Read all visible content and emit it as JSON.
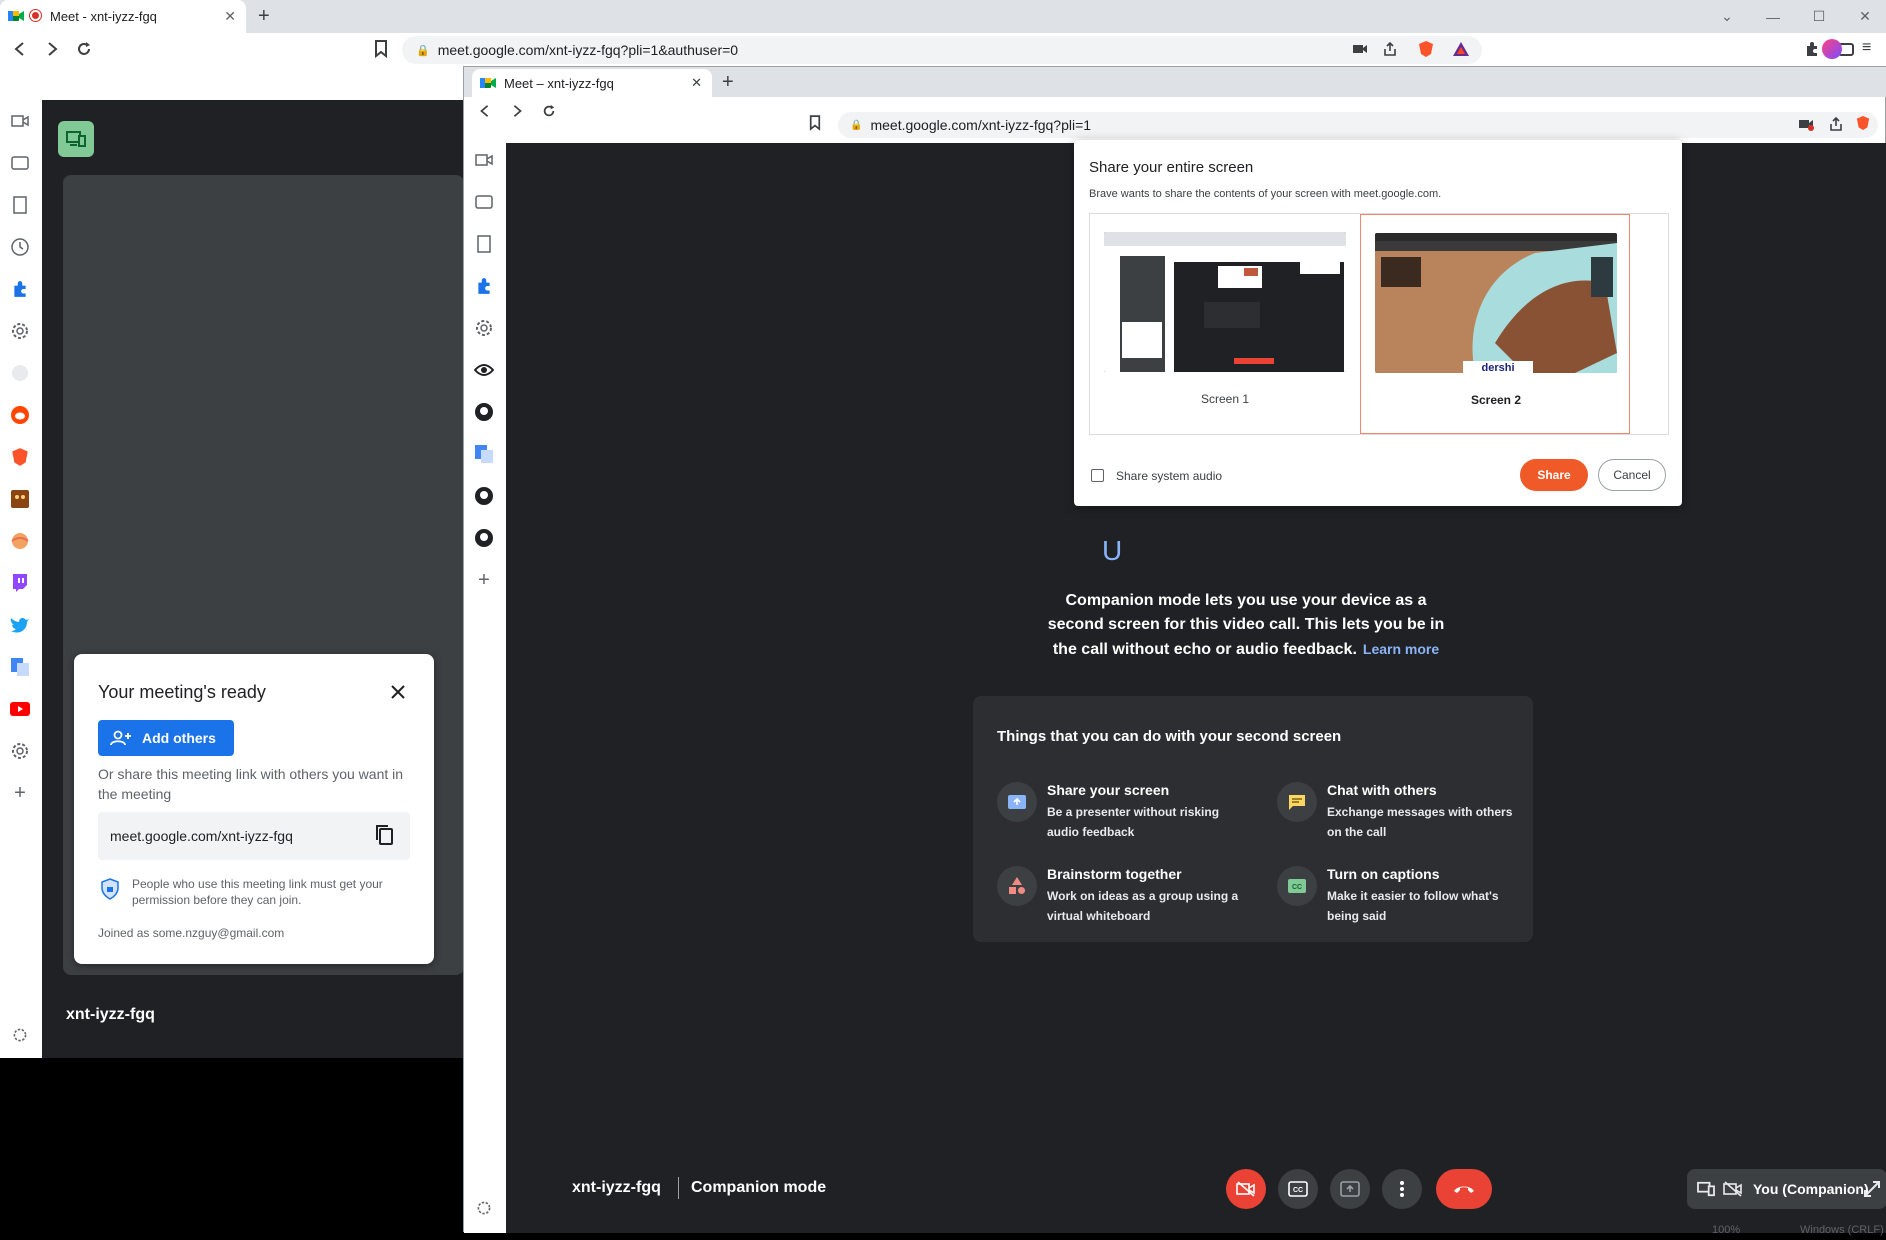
{
  "back_browser": {
    "tab_title": "Meet - xnt-iyzz-fgq",
    "url": "meet.google.com/xnt-iyzz-fgq?pli=1&authuser=0"
  },
  "back_meet": {
    "meeting_code": "xnt-iyzz-fgq"
  },
  "meeting_ready": {
    "title": "Your meeting's ready",
    "add_others_label": "Add others",
    "share_text": "Or share this meeting link with others you want in the meeting",
    "link": "meet.google.com/xnt-iyzz-fgq",
    "permission_note": "People who use this meeting link must get your permission before they can join.",
    "joined_as": "Joined as some.nzguy@gmail.com"
  },
  "front_browser": {
    "tab_title": "Meet – xnt-iyzz-fgq",
    "url": "meet.google.com/xnt-iyzz-fgq?pli=1"
  },
  "companion": {
    "partial_title": "U",
    "description": "Companion mode lets you use your device as a second screen for this video call. This lets you be in the call without echo or audio feedback.",
    "learn_more": "Learn more",
    "card_title": "Things that you can do with your second screen",
    "features": [
      {
        "title": "Share your screen",
        "desc": "Be a presenter without risking audio feedback",
        "icon": "present-icon"
      },
      {
        "title": "Chat with others",
        "desc": "Exchange messages with others on the call",
        "icon": "chat-icon"
      },
      {
        "title": "Brainstorm together",
        "desc": "Work on ideas as a group using a virtual whiteboard",
        "icon": "shapes-icon"
      },
      {
        "title": "Turn on captions",
        "desc": "Make it easier to follow what's being said",
        "icon": "captions-icon"
      }
    ]
  },
  "bottom_bar": {
    "meeting_code": "xnt-iyzz-fgq",
    "mode": "Companion mode"
  },
  "self_tile": {
    "label": "You (Companion)"
  },
  "share_dialog": {
    "title": "Share your entire screen",
    "description": "Brave wants to share the contents of your screen with meet.google.com.",
    "screens": [
      {
        "label": "Screen 1",
        "selected": false
      },
      {
        "label": "Screen 2",
        "selected": true
      }
    ],
    "audio_label": "Share system audio",
    "share_label": "Share",
    "cancel_label": "Cancel",
    "thumb2_text": "dershi"
  },
  "status": {
    "zoom": "100%",
    "os": "Windows (CRLF)"
  },
  "colors": {
    "meet_dark": "#202124",
    "accent_blue": "#1a73e8",
    "brave_orange": "#f05a28",
    "hangup_red": "#ea4335"
  }
}
